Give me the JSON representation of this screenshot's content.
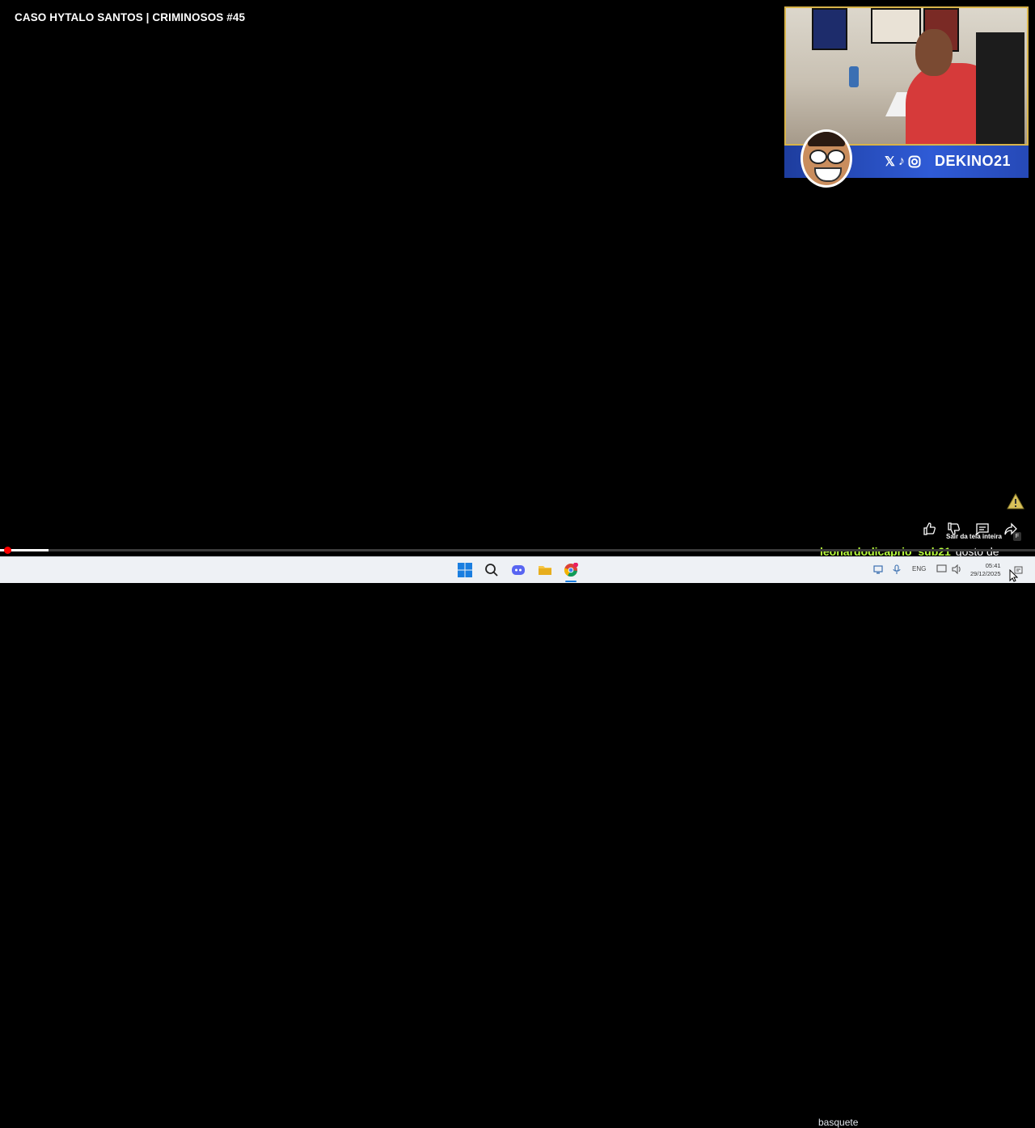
{
  "video": {
    "title": "CASO HYTALO SANTOS | CRIMINOSOS #45",
    "progress": 0.047
  },
  "webcam": {
    "handle": "DEKINO21",
    "social_icons": [
      "x-icon",
      "tiktok-icon",
      "instagram-icon"
    ]
  },
  "controls": {
    "like_icon": "like-icon",
    "dislike_icon": "dislike-icon",
    "comments_icon": "comments-icon",
    "share_icon": "share-icon",
    "exit_fullscreen_tooltip": "Sair da tela inteira",
    "exit_fullscreen_key": "F"
  },
  "chat": {
    "username": "leonardodicaprio_sub21",
    "message": "gosto de",
    "message2": "basquete"
  },
  "taskbar": {
    "apps": [
      "windows-start-icon",
      "search-icon",
      "discord-icon",
      "file-explorer-icon",
      "chrome-icon"
    ],
    "language": "ENG",
    "time": "05:41",
    "date": "29/12/2025"
  },
  "colors": {
    "progress_played": "#ffffff",
    "progress_scrubber": "#ff0000",
    "webcam_border": "#d8b44a",
    "banner_blue": "#2f5bd6",
    "chat_username": "#b8ff3c"
  }
}
